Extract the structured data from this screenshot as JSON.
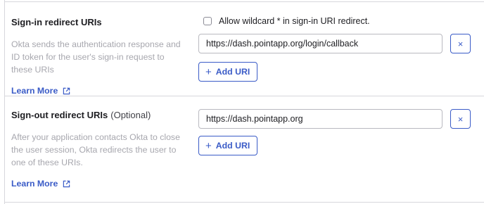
{
  "signin": {
    "label": "Sign-in redirect URIs",
    "description": "Okta sends the authentication response and ID token for the user's sign-in request to these URIs",
    "learn_more": "Learn More",
    "wildcard_label": "Allow wildcard * in sign-in URI redirect.",
    "wildcard_checked": false,
    "uris": [
      "https://dash.pointapp.org/login/callback"
    ],
    "remove_glyph": "×",
    "add_label": "Add URI"
  },
  "signout": {
    "label": "Sign-out redirect URIs",
    "optional": "(Optional)",
    "description": "After your application contacts Okta to close the user session, Okta redirects the user to one of these URIs.",
    "learn_more": "Learn More",
    "uris": [
      "https://dash.pointapp.org"
    ],
    "remove_glyph": "×",
    "add_label": "Add URI"
  },
  "icons": {
    "external_link": "external-link-icon",
    "close": "close-icon",
    "plus": "plus-icon"
  },
  "colors": {
    "accent": "#3a5bc7",
    "muted_text": "#a7a7ae",
    "border": "#d7d7dc"
  }
}
